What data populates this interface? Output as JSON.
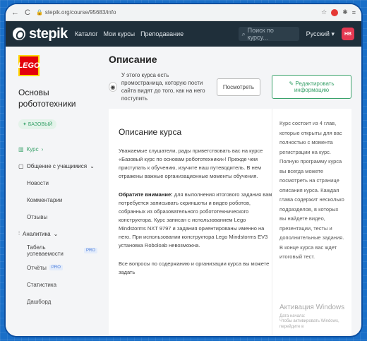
{
  "browser": {
    "url": "stepik.org/course/95683/info",
    "back": "←",
    "refresh": "C"
  },
  "header": {
    "logo": "stepik",
    "nav": [
      "Каталог",
      "Мои курсы",
      "Преподавание"
    ],
    "search_placeholder": "Поиск по курсу...",
    "language": "Русский",
    "avatar": "НВ"
  },
  "sidebar": {
    "course_logo": "LEGO",
    "course_title": "Основы робототехники",
    "tag": "БАЗОВЫЙ",
    "menu": {
      "course": "Курс",
      "students": "Общение с учащимися",
      "news": "Новости",
      "comments": "Комментарии",
      "reviews": "Отзывы",
      "analytics": "Аналитика",
      "gradebook": "Табель успеваемости",
      "reports": "Отчёты",
      "statistics": "Статистика",
      "dashboard": "Дашборд",
      "pro": "PRO"
    }
  },
  "main": {
    "title": "Описание",
    "promo_text": "У этого курса есть промостраница, которую пости сайта видят до того, как на него поступить",
    "view_button": "Посмотреть",
    "edit_button": "Редактировать информацию",
    "section_title": "Описание курса",
    "para1": "Уважаемые слушатели, рады приветствовать вас на курсе «Базовый курс по основам робототехники»! Прежде чем приступать к обучению, изучите наш путеводитель. В нем отражены важные организационные моменты обучения.",
    "para2_bold": "Обратите внимание:",
    "para2": " для выполнения итогового задания вам потребуется записывать скриншоты и видео роботов, собранных из образовательного робототехнического конструктора. Курс записан с использованием Lego Mindstorms NXT 9797 и задания ориентированы именно на него. При использовании конструктора Lego Mindstorms EV3 установка Roboloab невозможна.",
    "para3": "Все вопросы по содержанию и организации курса вы можете задать",
    "side_text": "Курс состоит из 4 глав, которые открыты для вас полностью с момента регистрации на курс. Полную программу курса вы всегда можете посмотреть на странице описания курса. Каждая глава содержит несколько подразделов, в которых вы найдете видео, презентации, тесты и дополнительные задания. В конце курса вас ждет итоговый тест.",
    "watermark_title": "Активация Windows",
    "watermark_sub": "Дата начала:",
    "watermark_hint": "Чтобы активировать Windows, перейдите в"
  }
}
